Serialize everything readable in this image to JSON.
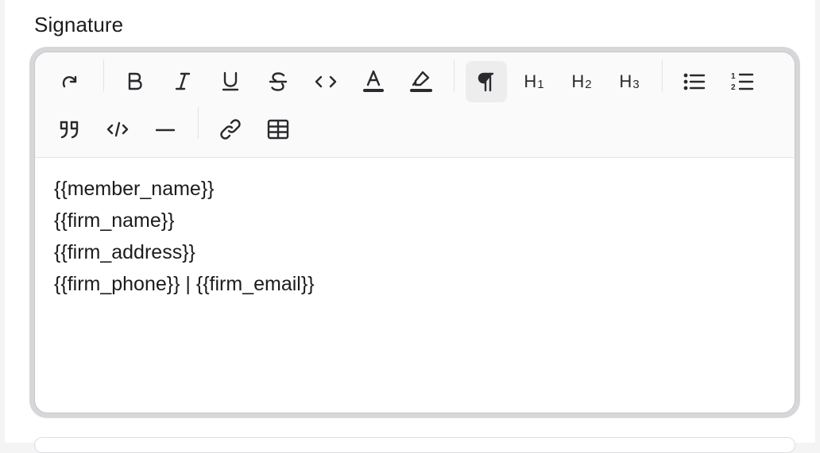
{
  "field": {
    "label": "Signature"
  },
  "toolbar": {
    "row1": [
      {
        "name": "redo-button",
        "icon": "redo-icon"
      },
      {
        "name": "bold-button",
        "icon": "bold-icon"
      },
      {
        "name": "italic-button",
        "icon": "italic-icon"
      },
      {
        "name": "underline-button",
        "icon": "underline-icon"
      },
      {
        "name": "strikethrough-button",
        "icon": "strikethrough-icon"
      },
      {
        "name": "inline-code-button",
        "icon": "code-icon"
      },
      {
        "name": "text-color-button",
        "icon": "text-color-icon"
      },
      {
        "name": "highlight-button",
        "icon": "highlighter-icon"
      },
      {
        "name": "paragraph-button",
        "icon": "pilcrow-icon",
        "active": true
      },
      {
        "name": "heading1-button",
        "icon": "heading-1-icon"
      },
      {
        "name": "heading2-button",
        "icon": "heading-2-icon"
      },
      {
        "name": "heading3-button",
        "icon": "heading-3-icon"
      },
      {
        "name": "bullet-list-button",
        "icon": "bullet-list-icon"
      },
      {
        "name": "ordered-list-button",
        "icon": "ordered-list-icon"
      }
    ],
    "row2": [
      {
        "name": "blockquote-button",
        "icon": "quote-icon"
      },
      {
        "name": "code-block-button",
        "icon": "code-block-icon"
      },
      {
        "name": "horizontal-rule-button",
        "icon": "horizontal-rule-icon"
      },
      {
        "name": "link-button",
        "icon": "link-icon"
      },
      {
        "name": "table-button",
        "icon": "table-icon"
      }
    ],
    "heading_labels": {
      "h1": "H",
      "h1_num": "1",
      "h2": "H",
      "h2_num": "2",
      "h3": "H",
      "h3_num": "3"
    },
    "ordered_list_digits": {
      "one": "1",
      "two": "2"
    }
  },
  "content": {
    "lines": [
      "{{member_name}}",
      "{{firm_name}}",
      "{{firm_address}}",
      "{{firm_phone}} | {{firm_email}}"
    ]
  },
  "colors": {
    "accent_text": "#1c1c1f",
    "toolbar_bg": "#fafafa",
    "active_bg": "#ededee",
    "ring": "#d7d7da"
  }
}
